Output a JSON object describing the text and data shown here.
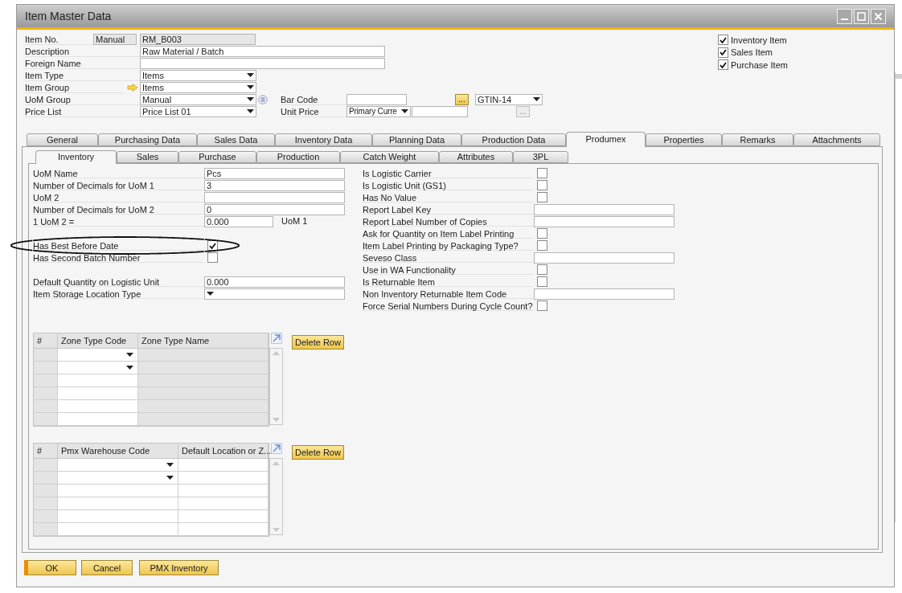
{
  "window": {
    "title": "Item Master Data"
  },
  "header": {
    "item_no": {
      "label": "Item No.",
      "series": "Manual",
      "value": "RM_B003"
    },
    "description": {
      "label": "Description",
      "value": "Raw Material / Batch"
    },
    "foreign_name": {
      "label": "Foreign Name"
    },
    "item_type": {
      "label": "Item Type",
      "value": "Items"
    },
    "item_group": {
      "label": "Item Group",
      "value": "Items"
    },
    "uom_group": {
      "label": "UoM Group",
      "value": "Manual"
    },
    "price_list": {
      "label": "Price List",
      "value": "Price List 01"
    },
    "bar_code": {
      "label": "Bar Code",
      "button": "...",
      "type": "GTIN-14"
    },
    "unit_price": {
      "label": "Unit Price",
      "currency": "Primary Curre",
      "button": "..."
    }
  },
  "flags": [
    {
      "label": "Inventory Item",
      "checked": true
    },
    {
      "label": "Sales Item",
      "checked": true
    },
    {
      "label": "Purchase Item",
      "checked": true
    }
  ],
  "tabs": [
    {
      "label": "General",
      "selected": false
    },
    {
      "label": "Purchasing Data",
      "selected": false
    },
    {
      "label": "Sales Data",
      "selected": false
    },
    {
      "label": "Inventory Data",
      "selected": false
    },
    {
      "label": "Planning Data",
      "selected": false
    },
    {
      "label": "Production Data",
      "selected": false
    },
    {
      "label": "Produmex",
      "selected": true
    },
    {
      "label": "Properties",
      "selected": false
    },
    {
      "label": "Remarks",
      "selected": false
    },
    {
      "label": "Attachments",
      "selected": false
    }
  ],
  "subtabs": [
    {
      "label": "Inventory",
      "selected": true
    },
    {
      "label": "Sales",
      "selected": false
    },
    {
      "label": "Purchase",
      "selected": false
    },
    {
      "label": "Production",
      "selected": false
    },
    {
      "label": "Catch Weight",
      "selected": false
    },
    {
      "label": "Attributes",
      "selected": false
    },
    {
      "label": "3PL",
      "selected": false
    }
  ],
  "left_groups": [
    [
      {
        "kind": "text",
        "label": "UoM Name",
        "value": "Pcs"
      },
      {
        "kind": "text",
        "label": "Number of Decimals for UoM 1",
        "value": "3"
      },
      {
        "kind": "text",
        "label": "UoM 2"
      },
      {
        "kind": "text",
        "label": "Number of Decimals for UoM 2",
        "value": "0"
      },
      {
        "kind": "text",
        "label": "1 UoM 2 =",
        "value": "0.000",
        "suffix": "UoM 1"
      }
    ],
    [
      {
        "kind": "checkbox",
        "label": "Has Best Before Date",
        "checked": true
      },
      {
        "kind": "checkbox",
        "label": "Has Second Batch Number",
        "checked": false
      }
    ],
    [
      {
        "kind": "text",
        "label": "Default Quantity on Logistic Unit",
        "value": "0.000"
      },
      {
        "kind": "dropdown",
        "label": "Item Storage Location Type"
      }
    ]
  ],
  "right_fields": [
    {
      "kind": "checkbox",
      "label": "Is Logistic Carrier",
      "checked": false
    },
    {
      "kind": "checkbox",
      "label": "Is Logistic Unit (GS1)",
      "checked": false
    },
    {
      "kind": "checkbox",
      "label": "Has No Value",
      "checked": false
    },
    {
      "kind": "text",
      "label": "Report Label Key"
    },
    {
      "kind": "text",
      "label": "Report Label Number of Copies"
    },
    {
      "kind": "checkbox",
      "label": "Ask for Quantity on Item Label Printing",
      "checked": false
    },
    {
      "kind": "checkbox",
      "label": "Item Label Printing by Packaging Type?",
      "checked": false
    },
    {
      "kind": "text",
      "label": "Seveso Class"
    },
    {
      "kind": "checkbox",
      "label": "Use in WA Functionality",
      "checked": false
    },
    {
      "kind": "checkbox",
      "label": "Is Returnable Item",
      "checked": false
    },
    {
      "kind": "text",
      "label": "Non Inventory Returnable Item Code"
    },
    {
      "kind": "checkbox",
      "label": "Force Serial Numbers During Cycle Count?",
      "checked": false
    }
  ],
  "tables": [
    {
      "columns": [
        {
          "label": "#",
          "kind": "index"
        },
        {
          "label": "Zone Type Code",
          "kind": "dropdown"
        },
        {
          "label": "Zone Type Name",
          "kind": "readonly"
        }
      ],
      "rows": [
        {
          "dropdown": true
        },
        {
          "dropdown": true
        },
        {
          "dropdown": false
        },
        {
          "dropdown": false
        },
        {
          "dropdown": false
        },
        {
          "dropdown": false
        }
      ],
      "button": "Delete Row"
    },
    {
      "columns": [
        {
          "label": "#",
          "kind": "index"
        },
        {
          "label": "Pmx Warehouse Code",
          "kind": "dropdown"
        },
        {
          "label": "Default Location or Z...",
          "kind": "text"
        }
      ],
      "rows": [
        {
          "dropdown": true
        },
        {
          "dropdown": true
        },
        {
          "dropdown": false
        },
        {
          "dropdown": false
        },
        {
          "dropdown": false
        },
        {
          "dropdown": false
        }
      ],
      "button": "Delete Row"
    }
  ],
  "buttons": [
    {
      "label": "OK",
      "kind": "default"
    },
    {
      "label": "Cancel",
      "kind": "normal"
    },
    {
      "label": "PMX Inventory",
      "kind": "normal"
    }
  ]
}
